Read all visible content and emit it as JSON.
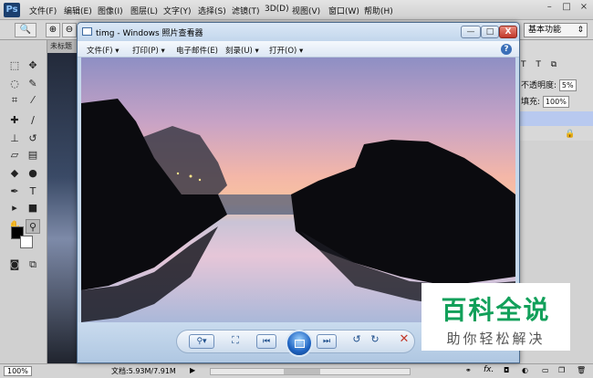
{
  "photoshop": {
    "logo": "Ps",
    "menus": [
      "文件(F)",
      "编辑(E)",
      "图像(I)",
      "图层(L)",
      "文字(Y)",
      "选择(S)",
      "滤镜(T)",
      "3D(D)",
      "视图(V)",
      "窗口(W)",
      "帮助(H)"
    ],
    "window_buttons": [
      "–",
      "□",
      "×"
    ],
    "workspace": "基本功能",
    "doc_tab": "未标题",
    "panels": {
      "opacity_label": "不透明度:",
      "opacity_value": "5%",
      "fill_label": "填充:",
      "fill_value": "100%"
    },
    "status": {
      "zoom": "100%",
      "doc_info": "文档:5.93M/7.91M"
    }
  },
  "viewer": {
    "title": "timg - Windows 照片查看器",
    "menu": [
      "文件(F)",
      "打印(P)",
      "电子邮件(E)",
      "刻录(U)",
      "打开(O)"
    ],
    "help": "?",
    "caption_buttons": [
      "—",
      "□",
      "X"
    ]
  },
  "watermark": {
    "title": "百科全说",
    "subtitle": "助你轻松解决"
  },
  "colors": {
    "viewer_frame": "#c5d7ea",
    "accent_blue": "#1e63c2",
    "watermark_green": "#12a05a",
    "close_red": "#c2382a"
  }
}
